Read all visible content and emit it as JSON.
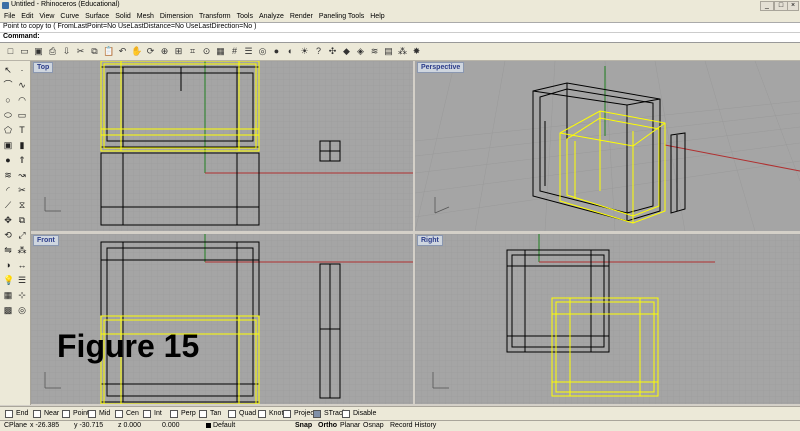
{
  "window": {
    "title": "Untitled - Rhinoceros (Educational)"
  },
  "menu": [
    "File",
    "Edit",
    "View",
    "Curve",
    "Surface",
    "Solid",
    "Mesh",
    "Dimension",
    "Transform",
    "Tools",
    "Analyze",
    "Render",
    "Paneling Tools",
    "Help"
  ],
  "command": {
    "history": "Point to copy to ( FromLastPoint=No  UseLastDistance=No  UseLastDirection=No )",
    "prompt_label": "Command:"
  },
  "toolbar_icons": [
    "new-icon",
    "open-icon",
    "save-icon",
    "print-icon",
    "import-icon",
    "cut-icon",
    "copy-icon",
    "paste-icon",
    "undo-icon",
    "pan-icon",
    "rotate-view-icon",
    "zoom-icon",
    "zoom-window-icon",
    "zoom-extents-icon",
    "zoom-selected-icon",
    "four-viewports-icon",
    "grid-icon",
    "layer-icon",
    "render-icon",
    "sphere-icon",
    "material-icon",
    "lights-icon",
    "help-icon",
    "transform-icon",
    "solid-icon",
    "shaded-icon",
    "flow-icon",
    "panel-icon",
    "array-icon",
    "explode-icon"
  ],
  "viewports": {
    "top": {
      "label": "Top"
    },
    "perspective": {
      "label": "Perspective"
    },
    "front": {
      "label": "Front"
    },
    "right": {
      "label": "Right"
    }
  },
  "overlay": {
    "figure_label": "Figure 15"
  },
  "osnaps": [
    {
      "label": "End",
      "checked": false
    },
    {
      "label": "Near",
      "checked": false
    },
    {
      "label": "Point",
      "checked": false
    },
    {
      "label": "Mid",
      "checked": false
    },
    {
      "label": "Cen",
      "checked": false
    },
    {
      "label": "Int",
      "checked": false
    },
    {
      "label": "Perp",
      "checked": false
    },
    {
      "label": "Tan",
      "checked": false
    },
    {
      "label": "Quad",
      "checked": false
    },
    {
      "label": "Knot",
      "checked": false
    },
    {
      "label": "Project",
      "checked": false
    },
    {
      "label": "STrack",
      "checked": true
    },
    {
      "label": "Disable",
      "checked": false
    }
  ],
  "status": {
    "cplane": "CPlane",
    "x": "x -26.385",
    "y": "y -30.715",
    "z": "z 0.000",
    "distance": "0.000",
    "layer": "Default",
    "toggles": [
      "Snap",
      "Ortho",
      "Planar",
      "Osnap",
      "Record History"
    ]
  },
  "colors": {
    "viewport_bg": "#a5a5a5",
    "grid_line": "#9a9a9a",
    "selected": "#ffff00",
    "axis_x": "#b03030",
    "axis_y": "#208020"
  }
}
